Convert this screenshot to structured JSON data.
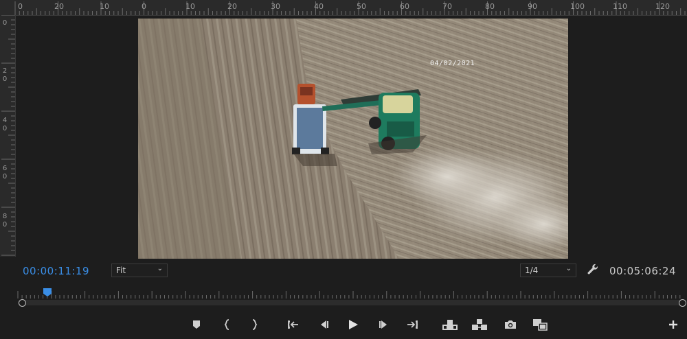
{
  "ruler": {
    "top_labels": [
      "0",
      "20",
      "10",
      "0",
      "10",
      "20",
      "30",
      "40",
      "50",
      "60",
      "70",
      "80",
      "90",
      "100",
      "110",
      "120"
    ],
    "left_labels": [
      "0",
      "2\n0",
      "4\n0",
      "6\n0",
      "8\n0"
    ]
  },
  "video": {
    "date_overlay": "04/02/2021"
  },
  "playback": {
    "current_time": "00:00:11:19",
    "duration": "00:05:06:24",
    "zoom": "Fit",
    "resolution": "1/4",
    "playhead_fraction": 0.036
  },
  "icons": {
    "marker": "add-marker-icon",
    "mark_in": "mark-in-icon",
    "mark_out": "mark-out-icon",
    "go_to_in": "go-to-in-icon",
    "step_back": "step-back-icon",
    "play": "play-icon",
    "step_forward": "step-forward-icon",
    "go_to_out": "go-to-out-icon",
    "lift": "lift-icon",
    "extract": "extract-icon",
    "export_frame": "camera-icon",
    "compare": "compare-view-icon",
    "button_editor": "plus-icon",
    "settings": "wrench-icon"
  },
  "colors": {
    "accent": "#3a8ee6",
    "panel": "#1d1d1d"
  }
}
